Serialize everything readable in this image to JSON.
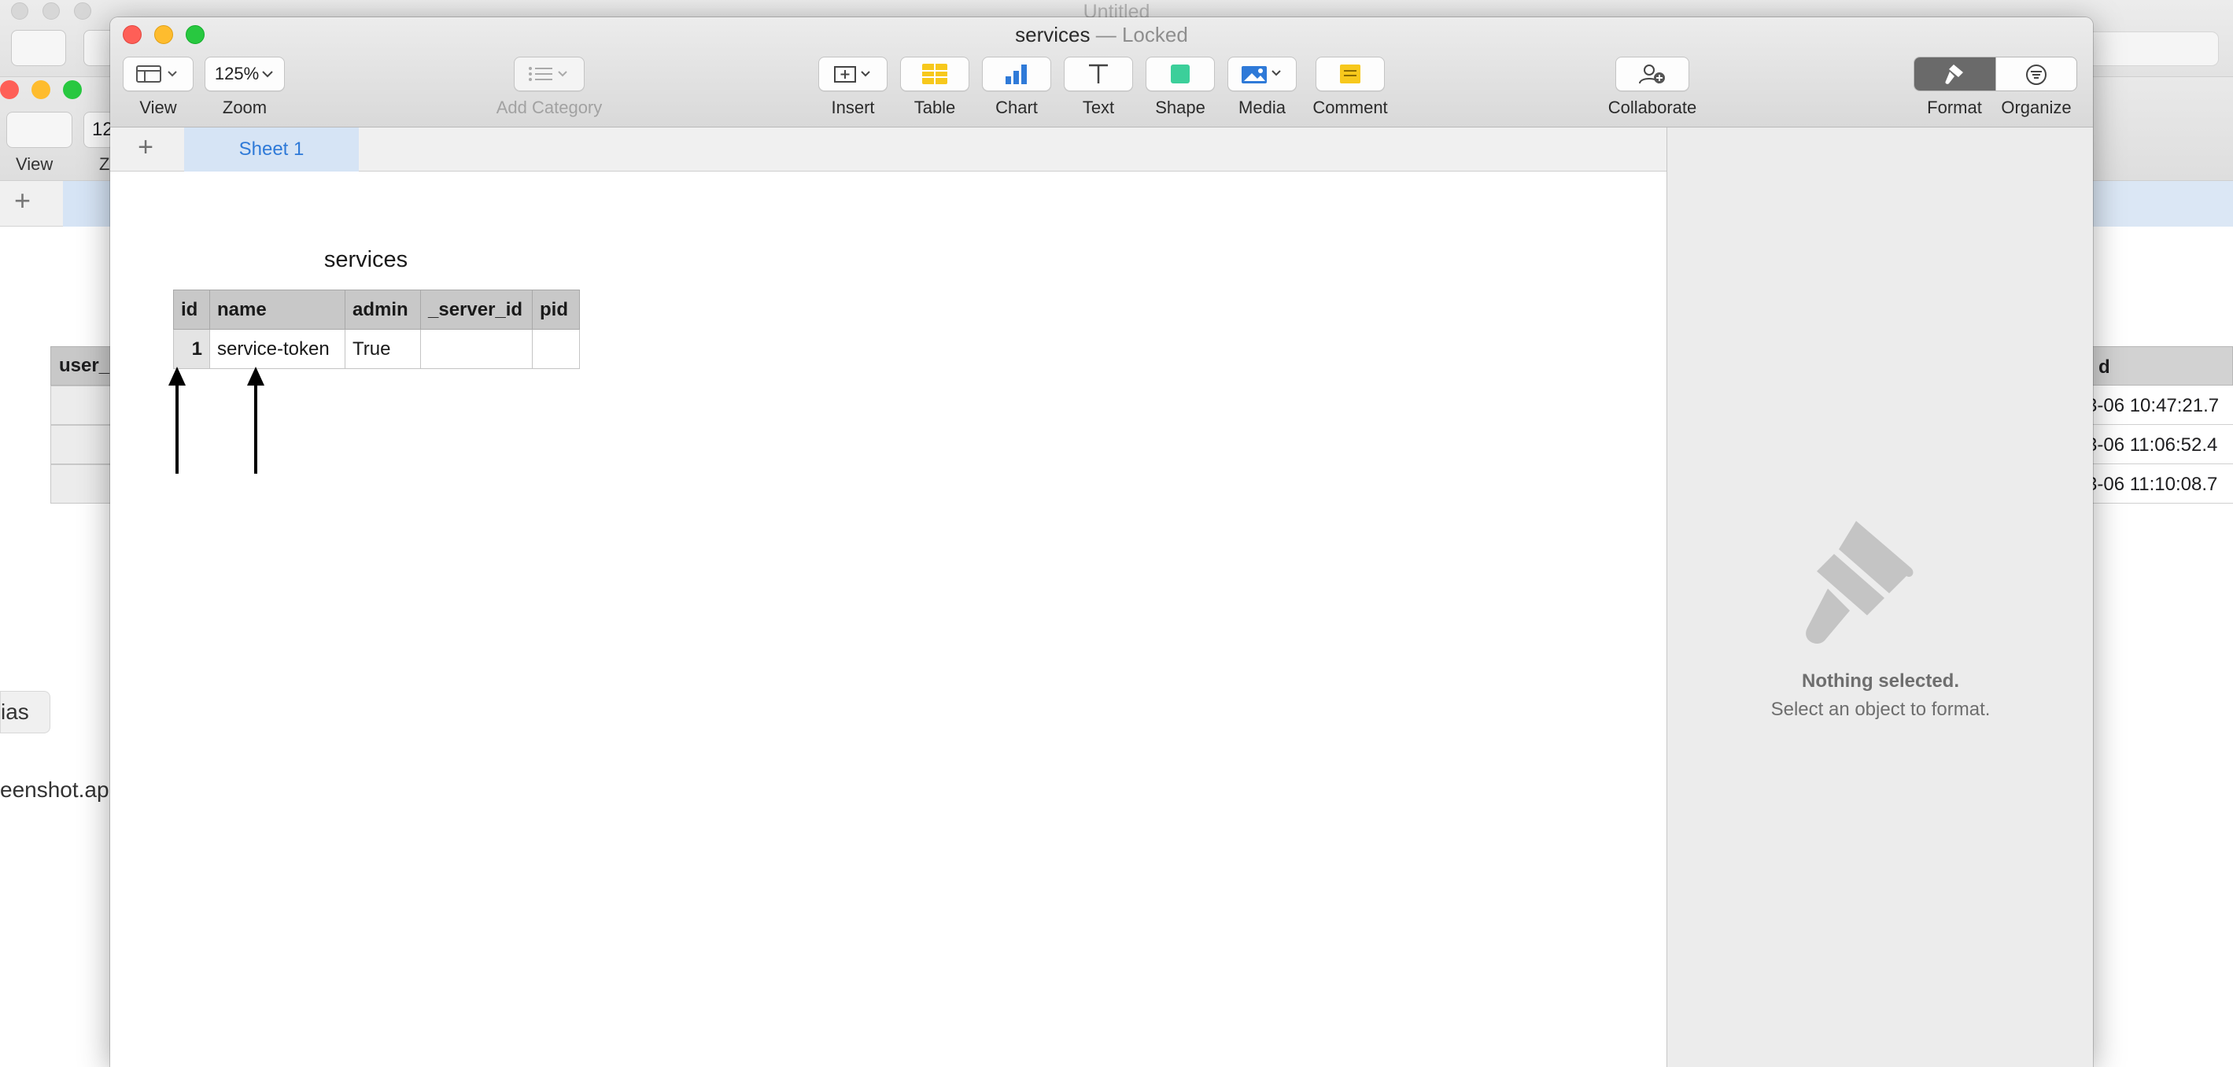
{
  "background_window": {
    "title": "Untitled",
    "toolbar_labels": [
      "View",
      "Z"
    ],
    "zoom_partial": "12",
    "table_header_partial": "user_",
    "right_column_header_partial": "d",
    "right_column_values": [
      "3-06 10:47:21.7",
      "3-06 11:06:52.4",
      "3-06 11:10:08.7"
    ],
    "chip_text": "ias",
    "filename_text": "eenshot.ap"
  },
  "window": {
    "title": "services",
    "title_status": "— Locked"
  },
  "toolbar": {
    "view_label": "View",
    "zoom_value": "125%",
    "zoom_label": "Zoom",
    "add_category_label": "Add Category",
    "insert_label": "Insert",
    "table_label": "Table",
    "chart_label": "Chart",
    "text_label": "Text",
    "shape_label": "Shape",
    "media_label": "Media",
    "comment_label": "Comment",
    "collaborate_label": "Collaborate",
    "format_label": "Format",
    "organize_label": "Organize"
  },
  "sheets": {
    "add_symbol": "+",
    "tabs": [
      "Sheet 1"
    ]
  },
  "table": {
    "title": "services",
    "columns": [
      "id",
      "name",
      "admin",
      "_server_id",
      "pid"
    ],
    "rows": [
      [
        "1",
        "service-token",
        "True",
        "",
        ""
      ]
    ]
  },
  "inspector": {
    "title": "Nothing selected.",
    "subtitle": "Select an object to format."
  },
  "colors": {
    "sheet_tab_bg": "#d6e4f5",
    "sheet_tab_text": "#2f7ad8",
    "close": "#fe5f57",
    "minimize": "#febc2e",
    "maximize": "#28c840",
    "chart_icon": "#2f7ad8",
    "shape_icon": "#3ccf9a",
    "comment_icon": "#f7c81c"
  }
}
